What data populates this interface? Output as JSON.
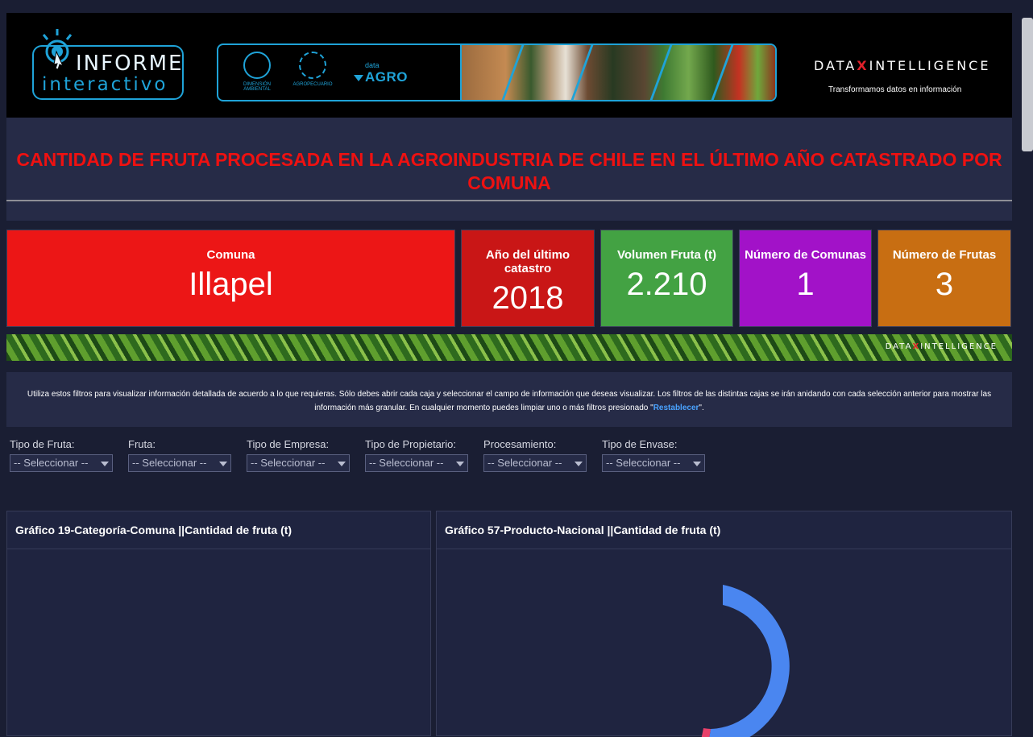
{
  "header": {
    "logo_line1": "INFORME",
    "logo_line2": "interactivo",
    "partner1": "DIMENSIÓN AMBIENTAL",
    "partner2": "AGROPECUARIO",
    "dataagro_small": "data",
    "dataagro_big": "AGRO",
    "di_left": "DATA",
    "di_right": "INTELLIGENCE",
    "di_tagline": "Transformamos datos en información"
  },
  "title": "CANTIDAD DE FRUTA PROCESADA EN LA AGROINDUSTRIA DE CHILE EN EL ÚLTIMO AÑO CATASTRADO POR COMUNA",
  "kpis": [
    {
      "label": "Comuna",
      "value": "Illapel"
    },
    {
      "label": "Año del último catastro",
      "value": "2018"
    },
    {
      "label": "Volumen Fruta (t)",
      "value": "2.210"
    },
    {
      "label": "Número de Comunas",
      "value": "1"
    },
    {
      "label": "Número de Frutas",
      "value": "3"
    }
  ],
  "info": {
    "text_before": "Utiliza estos filtros para visualizar información detallada de acuerdo a lo que requieras. Sólo debes abrir cada caja y seleccionar el campo de información que deseas visualizar. Los filtros de las distintas cajas se irán anidando con cada selección anterior para mostrar las información más granular. En cualquier momento puedes limpiar uno o más filtros presionado \"",
    "link": "Restablecer",
    "text_after": "\"."
  },
  "filters": [
    {
      "label": "Tipo de Fruta:",
      "value": "-- Seleccionar --"
    },
    {
      "label": "Fruta:",
      "value": "-- Seleccionar --"
    },
    {
      "label": "Tipo de Empresa:",
      "value": "-- Seleccionar --"
    },
    {
      "label": "Tipo de Propietario:",
      "value": "-- Seleccionar --"
    },
    {
      "label": "Procesamiento:",
      "value": "-- Seleccionar --"
    },
    {
      "label": "Tipo de Envase:",
      "value": "-- Seleccionar --"
    }
  ],
  "charts": {
    "left_title": "Gráfico 19-Categoría-Comuna ||Cantidad de fruta (t)",
    "right_title": "Gráfico 57-Producto-Nacional ||Cantidad de fruta (t)"
  },
  "colors": {
    "comuna": "#ec1616",
    "anio": "#c91616",
    "volumen": "#43a243",
    "comunas": "#a212c8",
    "frutas": "#c86e12",
    "donut_main": "#4a86f0",
    "donut_second": "#e8416a"
  }
}
